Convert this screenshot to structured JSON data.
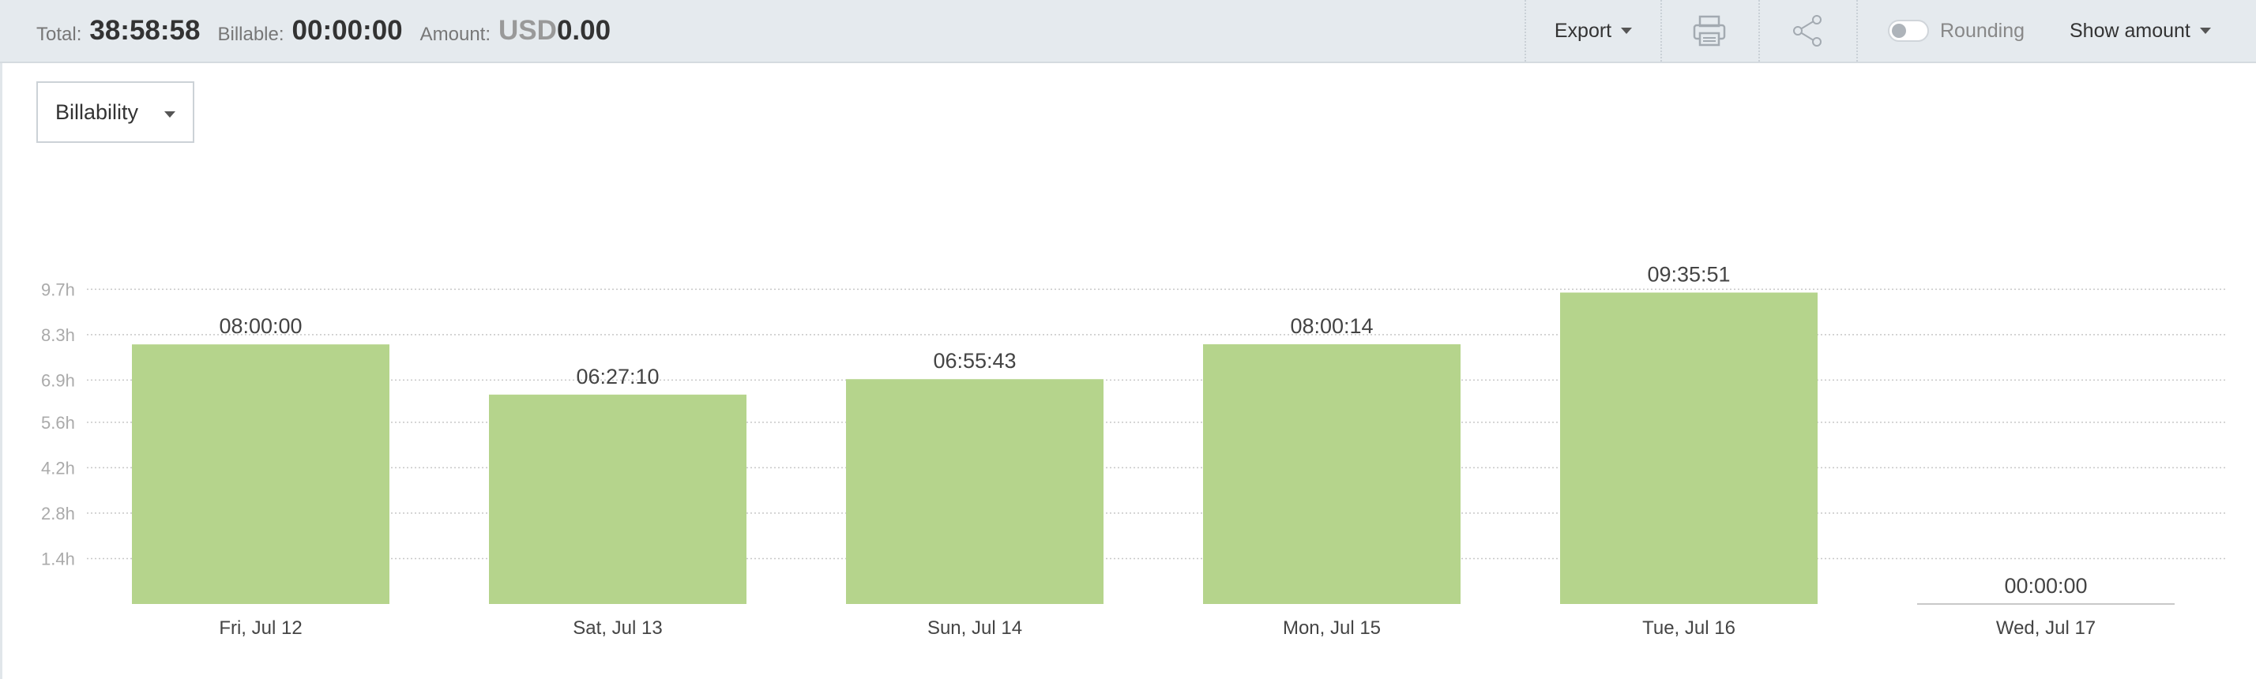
{
  "summary": {
    "total_label": "Total:",
    "total_value": "38:58:58",
    "billable_label": "Billable:",
    "billable_value": "00:00:00",
    "amount_label": "Amount:",
    "amount_currency": "USD",
    "amount_value": "0.00"
  },
  "toolbar": {
    "export_label": "Export",
    "print_icon": "printer-icon",
    "share_icon": "share-icon",
    "rounding_label": "Rounding",
    "rounding_on": false,
    "show_amount_label": "Show amount"
  },
  "group_dropdown": {
    "selected": "Billability"
  },
  "colors": {
    "bar": "#b5d48c",
    "grid": "#c8c8c8",
    "topbar": "#e5eaee"
  },
  "chart_data": {
    "type": "bar",
    "categories": [
      "Fri, Jul 12",
      "Sat, Jul 13",
      "Sun, Jul 14",
      "Mon, Jul 15",
      "Tue, Jul 16",
      "Wed, Jul 17"
    ],
    "values": [
      8.0,
      6.4528,
      6.9286,
      8.0039,
      9.5975,
      0.0
    ],
    "value_labels": [
      "08:00:00",
      "06:27:10",
      "06:55:43",
      "08:00:14",
      "09:35:51",
      "00:00:00"
    ],
    "y_ticks": [
      1.4,
      2.8,
      4.2,
      5.6,
      6.9,
      8.3,
      9.7
    ],
    "y_tick_labels": [
      "1.4h",
      "2.8h",
      "4.2h",
      "5.6h",
      "6.9h",
      "8.3h",
      "9.7h"
    ],
    "ylim": [
      0,
      9.7
    ],
    "grid": true,
    "grid_style": "dotted",
    "xlabel": "",
    "ylabel": ""
  }
}
